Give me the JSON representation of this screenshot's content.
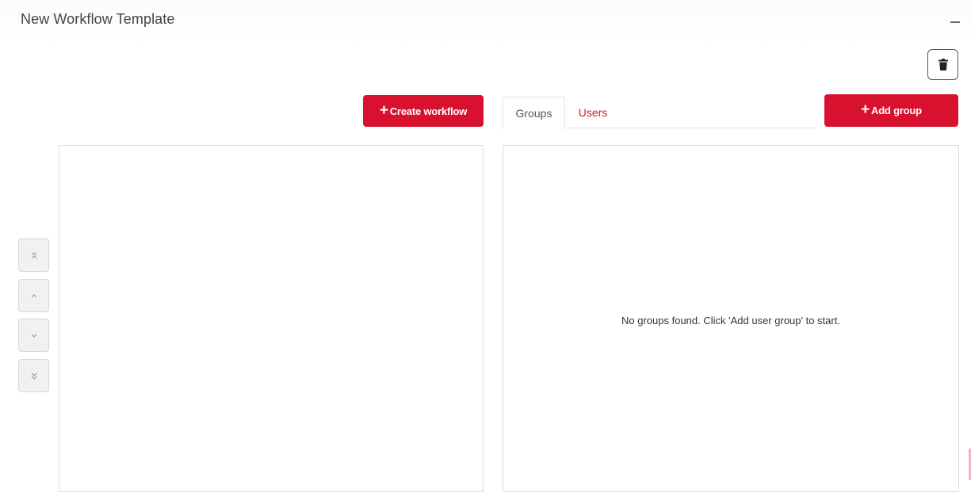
{
  "panel": {
    "title": "New Workflow Template",
    "collapse_icon": "minus-icon"
  },
  "toolbar": {
    "delete_icon": "trash-icon"
  },
  "workflow": {
    "create_label": "Create workflow",
    "create_icon": "plus-icon",
    "move_buttons": [
      {
        "name": "move-top-button",
        "icon": "double-chevron-up-icon"
      },
      {
        "name": "move-up-button",
        "icon": "chevron-up-icon"
      },
      {
        "name": "move-down-button",
        "icon": "chevron-down-icon"
      },
      {
        "name": "move-bottom-button",
        "icon": "double-chevron-down-icon"
      }
    ]
  },
  "assignments": {
    "tabs": [
      {
        "label": "Groups",
        "active": true
      },
      {
        "label": "Users",
        "active": false
      }
    ],
    "add_group_label": "Add group",
    "empty_message": "No groups found. Click 'Add user group' to start."
  },
  "colors": {
    "primary": "#d8112f",
    "border": "#dcdcdc",
    "muted_button": "#f1f1f1"
  }
}
